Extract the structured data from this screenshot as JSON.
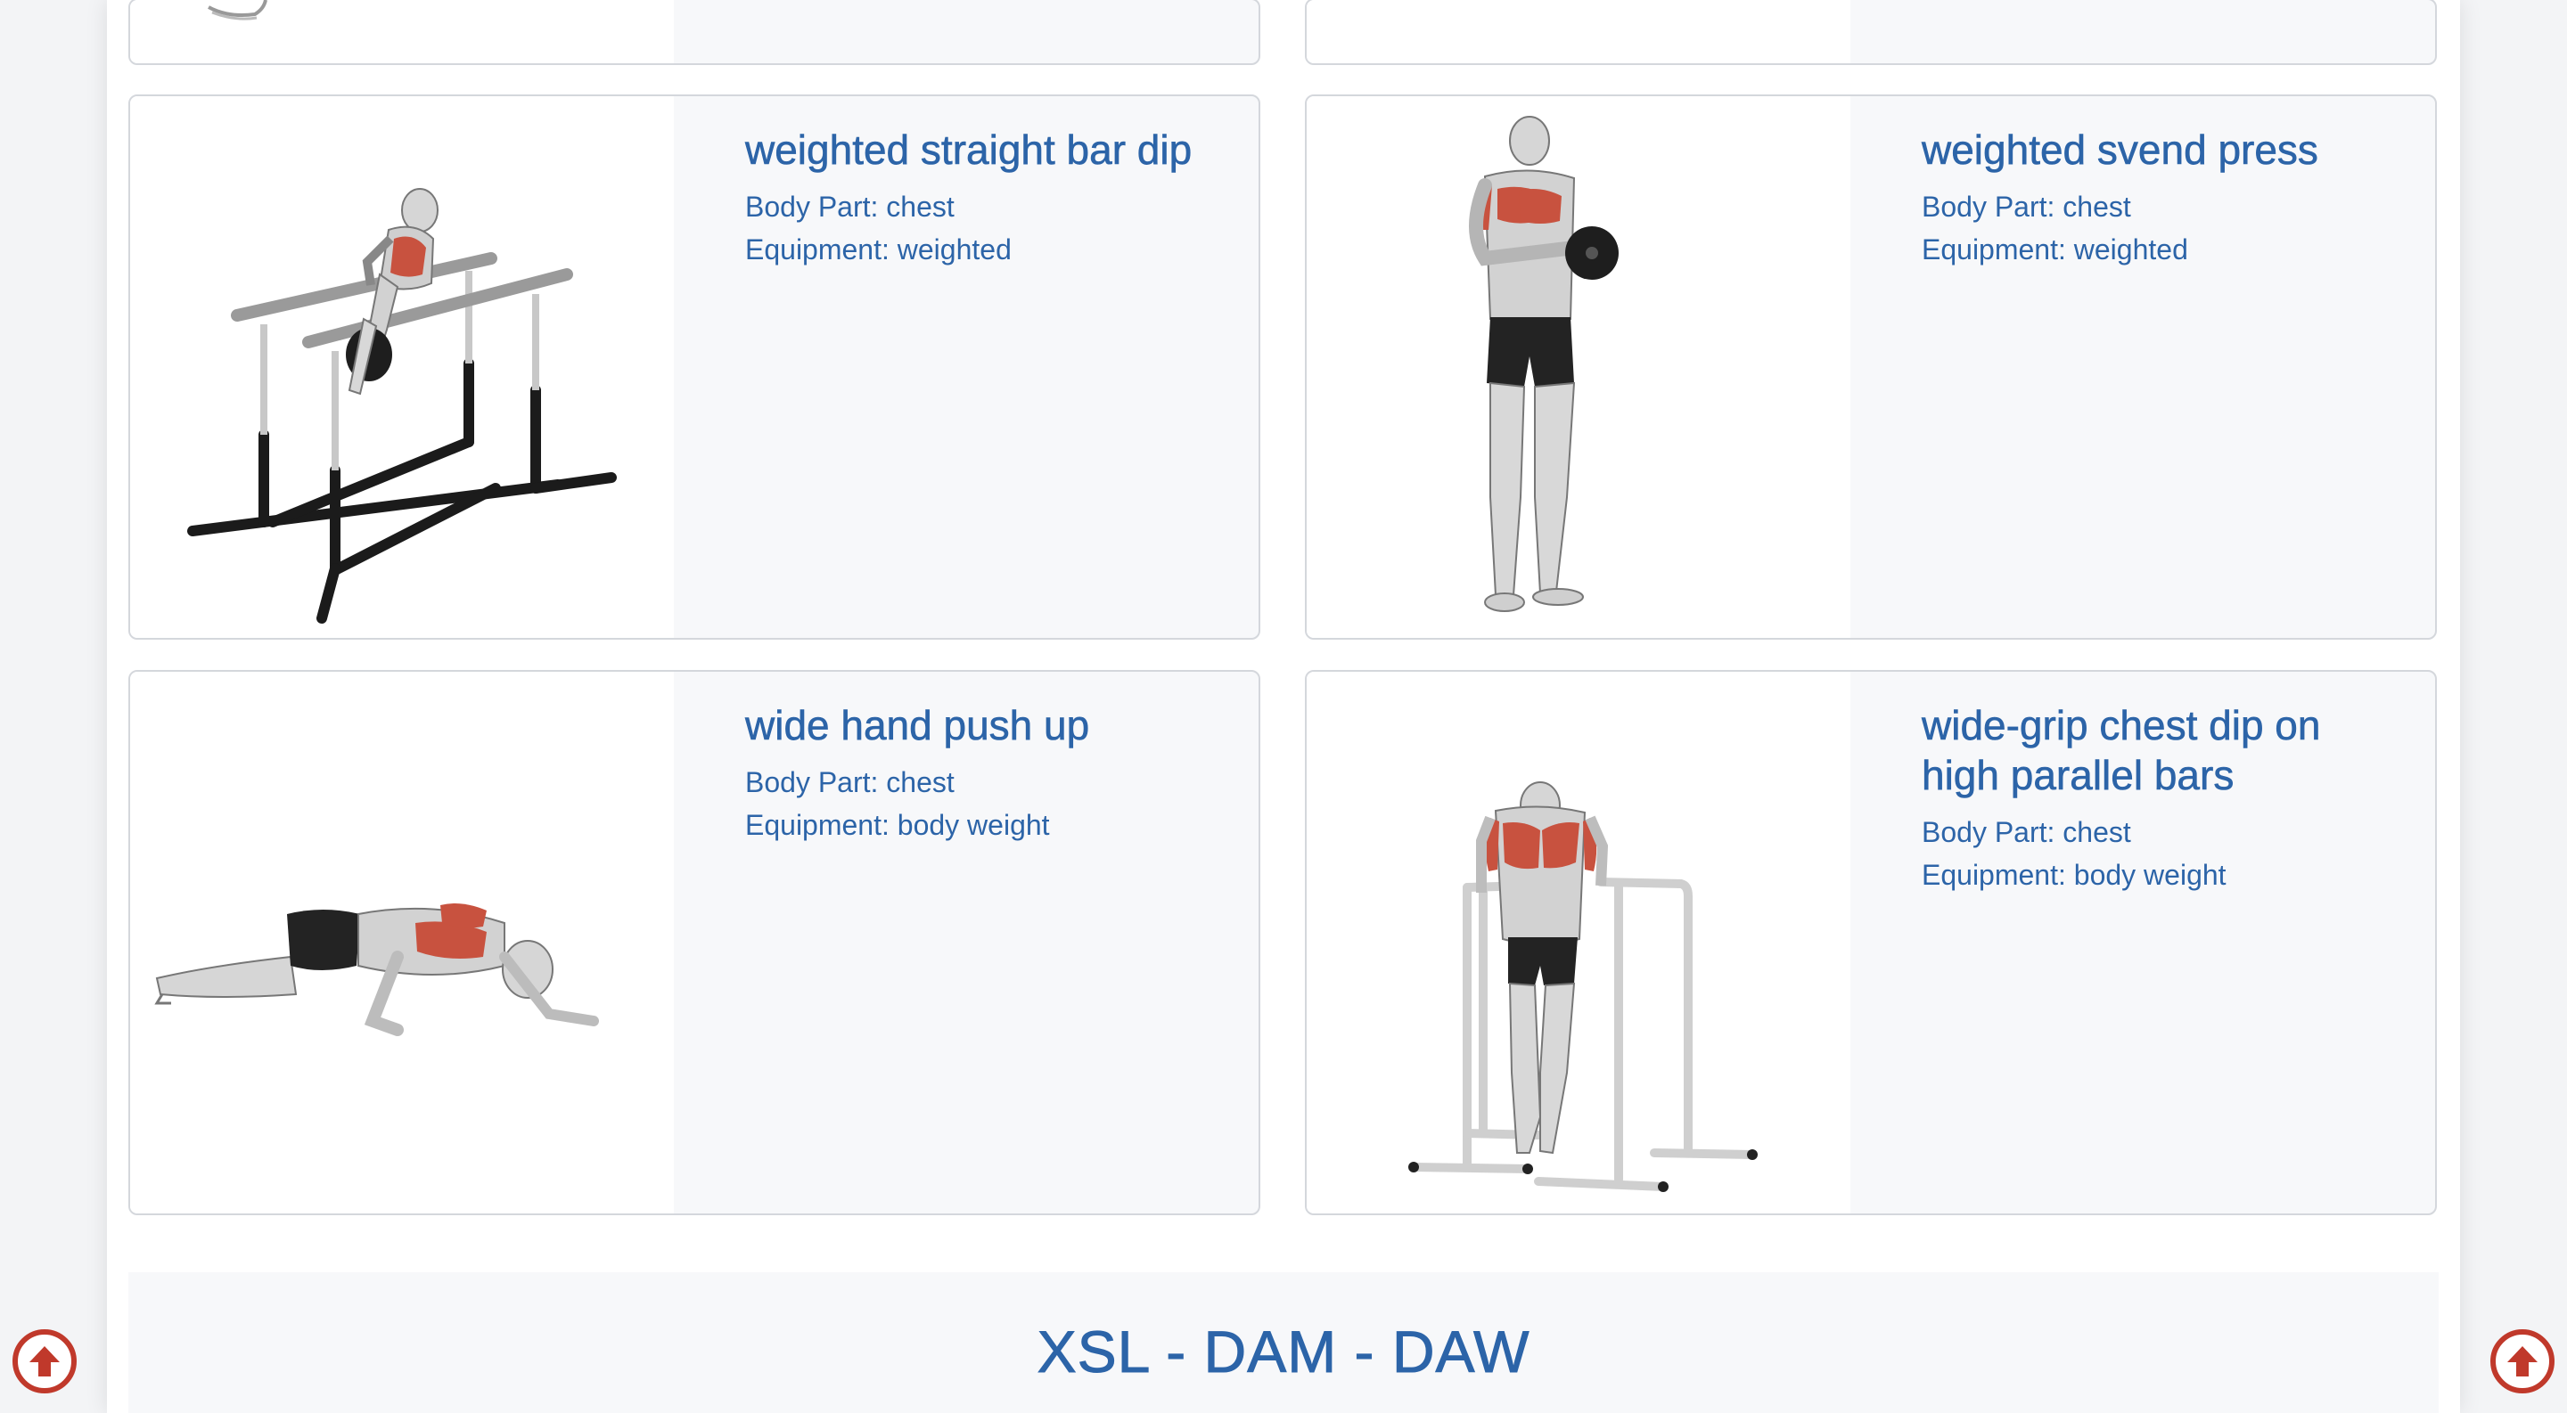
{
  "exercises": [
    {
      "name": "weighted straight bar dip",
      "body_part": "Body Part: chest",
      "equipment": "Equipment: weighted"
    },
    {
      "name": "weighted svend press",
      "body_part": "Body Part: chest",
      "equipment": "Equipment: weighted"
    },
    {
      "name": "wide hand push up",
      "body_part": "Body Part: chest",
      "equipment": "Equipment: body weight"
    },
    {
      "name": "wide-grip chest dip on high parallel bars",
      "body_part": "Body Part: chest",
      "equipment": "Equipment: body weight"
    }
  ],
  "footer": {
    "brand": "XSL - DAM - DAW"
  },
  "icons": {
    "scroll_top": "arrow-up-circle-icon"
  },
  "colors": {
    "accent_text": "#2c64a8",
    "scroll_button": "#c0392b",
    "muscle_highlight": "#c8523f"
  }
}
